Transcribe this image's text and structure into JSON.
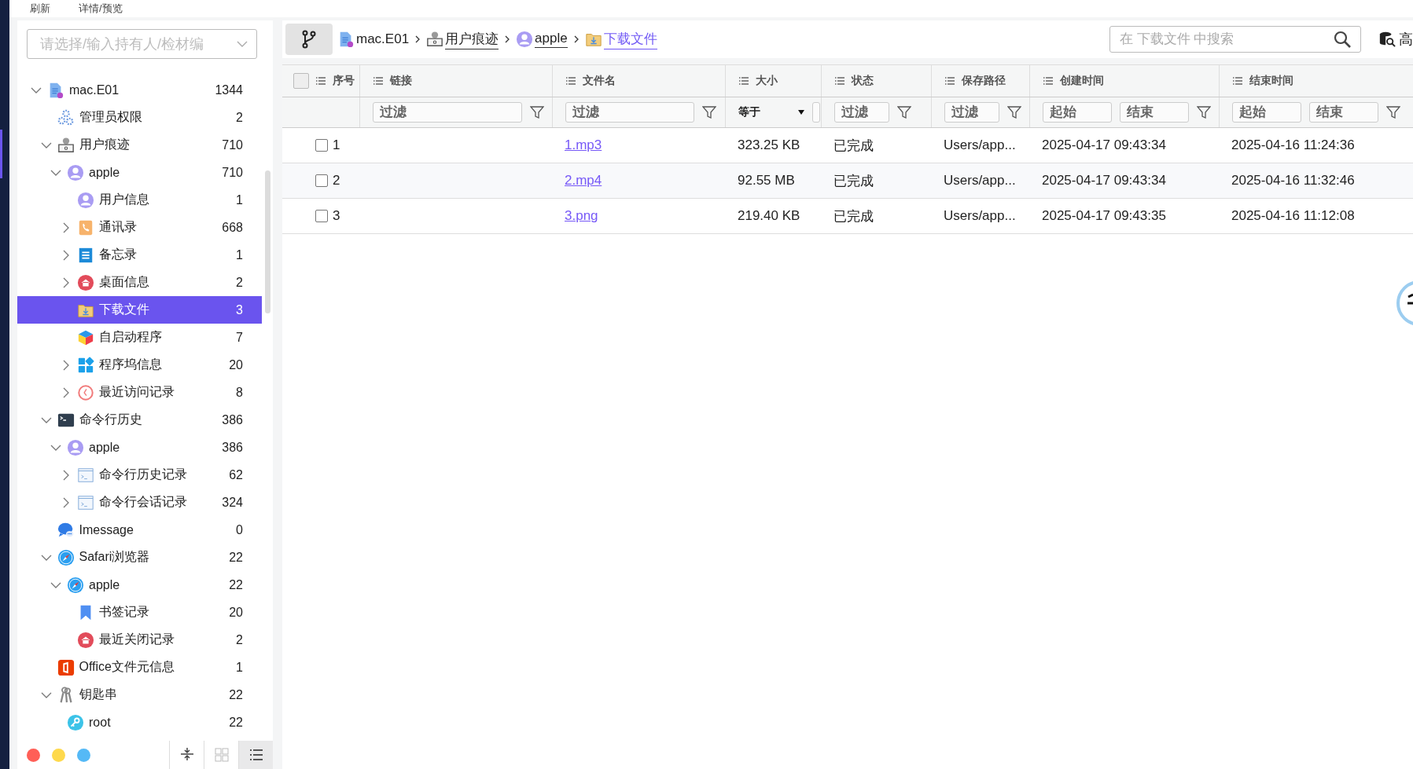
{
  "top_menu": [
    {
      "label": "刷新"
    },
    {
      "label": "详情/预览"
    }
  ],
  "sidebar": {
    "search": {
      "placeholder": "请选择/输入持有人/检材编"
    },
    "tree": [
      {
        "label": "mac.E01",
        "count": "1344",
        "kind": "device",
        "expanded": true,
        "selected": false,
        "children": [
          {
            "label": "管理员权限",
            "count": "2",
            "kind": "gears",
            "selected": false
          },
          {
            "label": "用户痕迹",
            "count": "710",
            "kind": "user-trace",
            "expanded": true,
            "selected": false,
            "children": [
              {
                "label": "apple",
                "count": "710",
                "kind": "user",
                "expanded": true,
                "selected": false,
                "children": [
                  {
                    "label": "用户信息",
                    "count": "1",
                    "kind": "user",
                    "selected": false
                  },
                  {
                    "label": "通讯录",
                    "count": "668",
                    "kind": "contacts",
                    "expanded": false,
                    "selected": false
                  },
                  {
                    "label": "备忘录",
                    "count": "1",
                    "kind": "notes",
                    "expanded": false,
                    "selected": false
                  },
                  {
                    "label": "桌面信息",
                    "count": "2",
                    "kind": "home",
                    "expanded": false,
                    "selected": false
                  },
                  {
                    "label": "下载文件",
                    "count": "3",
                    "kind": "folder",
                    "selected": true
                  },
                  {
                    "label": "自启动程序",
                    "count": "7",
                    "kind": "cube",
                    "selected": false
                  },
                  {
                    "label": "程序坞信息",
                    "count": "20",
                    "kind": "apps",
                    "expanded": false,
                    "selected": false
                  },
                  {
                    "label": "最近访问记录",
                    "count": "8",
                    "kind": "clock",
                    "expanded": false,
                    "selected": false
                  }
                ]
              }
            ]
          },
          {
            "label": "命令行历史",
            "count": "386",
            "kind": "terminal",
            "expanded": true,
            "selected": false,
            "children": [
              {
                "label": "apple",
                "count": "386",
                "kind": "user",
                "expanded": true,
                "selected": false,
                "children": [
                  {
                    "label": "命令行历史记录",
                    "count": "62",
                    "kind": "console",
                    "expanded": false,
                    "selected": false
                  },
                  {
                    "label": "命令行会话记录",
                    "count": "324",
                    "kind": "console",
                    "expanded": false,
                    "selected": false
                  }
                ]
              }
            ]
          },
          {
            "label": "Imessage",
            "count": "0",
            "kind": "chat",
            "selected": false
          },
          {
            "label": "Safari浏览器",
            "count": "22",
            "kind": "compass",
            "expanded": true,
            "selected": false,
            "children": [
              {
                "label": "apple",
                "count": "22",
                "kind": "compass",
                "expanded": true,
                "selected": false,
                "children": [
                  {
                    "label": "书签记录",
                    "count": "20",
                    "kind": "bookmark",
                    "selected": false
                  },
                  {
                    "label": "最近关闭记录",
                    "count": "2",
                    "kind": "home",
                    "selected": false
                  }
                ]
              }
            ]
          },
          {
            "label": "Office文件元信息",
            "count": "1",
            "kind": "office",
            "selected": false
          },
          {
            "label": "钥匙串",
            "count": "22",
            "kind": "keys",
            "expanded": true,
            "selected": false,
            "children": [
              {
                "label": "root",
                "count": "22",
                "kind": "key",
                "selected": false
              }
            ]
          }
        ]
      }
    ],
    "color_dots": [
      {
        "color": "#ff5f57"
      },
      {
        "color": "#fed94c"
      },
      {
        "color": "#55b9f6"
      }
    ],
    "view_toggles": [
      {
        "kind": "collapse",
        "selected": false
      },
      {
        "kind": "grid",
        "selected": false
      },
      {
        "kind": "list",
        "selected": true
      }
    ]
  },
  "breadcrumb": [
    {
      "label": "mac.E01",
      "kind": "device",
      "link": false,
      "selected": false
    },
    {
      "label": "用户痕迹",
      "kind": "user-trace",
      "link": true,
      "selected": false
    },
    {
      "label": "apple",
      "kind": "user",
      "link": true,
      "selected": false
    },
    {
      "label": "下载文件",
      "kind": "folder",
      "link": true,
      "selected": true
    }
  ],
  "search": {
    "placeholder": "在 下载文件 中搜索"
  },
  "advanced_button": {
    "label": "高"
  },
  "table": {
    "header_checkbox": {
      "checked": false
    },
    "columns": [
      {
        "label": "序号"
      },
      {
        "label": "链接",
        "filter": {
          "kind": "text",
          "placeholder": "过滤"
        }
      },
      {
        "label": "文件名",
        "filter": {
          "kind": "text",
          "placeholder": "过滤"
        }
      },
      {
        "label": "大小",
        "filter": {
          "kind": "compare",
          "value": "等于"
        }
      },
      {
        "label": "状态",
        "filter": {
          "kind": "text",
          "placeholder": "过滤"
        }
      },
      {
        "label": "保存路径",
        "filter": {
          "kind": "text",
          "placeholder": "过滤"
        }
      },
      {
        "label": "创建时间",
        "filter": {
          "kind": "range",
          "from_placeholder": "起始",
          "to_placeholder": "结束"
        }
      },
      {
        "label": "结束时间",
        "filter": {
          "kind": "range",
          "from_placeholder": "起始",
          "to_placeholder": "结束"
        }
      }
    ],
    "rows": [
      {
        "checked": false,
        "index": "1",
        "file_name": "1.mp3",
        "size": "323.25 KB",
        "status": "已完成",
        "path": "Users/app...",
        "created": "2025-04-17 09:43:34",
        "ended": "2025-04-16 11:24:36"
      },
      {
        "checked": false,
        "index": "2",
        "file_name": "2.mp4",
        "size": "92.55 MB",
        "status": "已完成",
        "path": "Users/app...",
        "created": "2025-04-17 09:43:34",
        "ended": "2025-04-16 11:32:46"
      },
      {
        "checked": false,
        "index": "3",
        "file_name": "3.png",
        "size": "219.40 KB",
        "status": "已完成",
        "path": "Users/app...",
        "created": "2025-04-17 09:43:35",
        "ended": "2025-04-16 11:12:08"
      }
    ]
  }
}
